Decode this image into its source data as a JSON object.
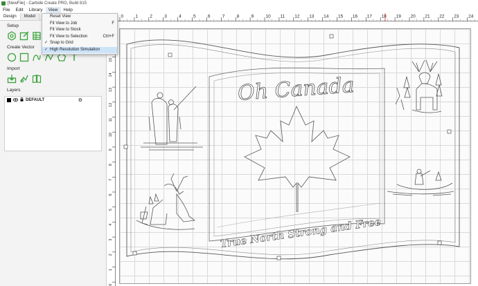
{
  "window": {
    "title": "[NewFile] - Carbide Create PRO, Build 815"
  },
  "menu": {
    "items": [
      "File",
      "Edit",
      "Library",
      "View",
      "Help"
    ],
    "active": "View"
  },
  "view_menu": {
    "items": [
      {
        "label": "Reset View",
        "shortcut": "",
        "checked": false,
        "highlight": false
      },
      {
        "label": "Fit View to Job",
        "shortcut": "F",
        "checked": false,
        "highlight": false
      },
      {
        "label": "Fit View to Stock",
        "shortcut": "",
        "checked": false,
        "highlight": false
      },
      {
        "label": "Fit View to Selection",
        "shortcut": "Ctrl+F",
        "checked": false,
        "highlight": false
      },
      {
        "label": "Snap to Grid",
        "shortcut": "",
        "checked": true,
        "highlight": false
      },
      {
        "label": "High Resolution Simulation",
        "shortcut": "",
        "checked": true,
        "highlight": true
      }
    ]
  },
  "sidebar": {
    "tabs": [
      "Design",
      "Model"
    ],
    "active_tab": "Design",
    "sections": {
      "setup": "Setup",
      "create_vector": "Create Vector",
      "import": "Import",
      "layers": "Layers"
    },
    "layers": [
      {
        "name": "DEFAULT",
        "color": "#000000"
      }
    ]
  },
  "rulers": {
    "horizontal": [
      "0",
      "1",
      "2",
      "3",
      "4",
      "5",
      "6",
      "7",
      "8",
      "9",
      "10",
      "11",
      "12",
      "13",
      "14",
      "15",
      "16",
      "17",
      "18",
      "19",
      "20",
      "21",
      "22",
      "23",
      "24"
    ],
    "vertical": [
      "16",
      "15",
      "14",
      "13",
      "12",
      "11",
      "10",
      "9",
      "8",
      "7",
      "6",
      "5",
      "4",
      "3",
      "2",
      "1",
      "0"
    ]
  },
  "design_text": {
    "title": "Oh Canada",
    "banner": "True North Strong and Free"
  },
  "colors": {
    "accent": "#3aa23a",
    "highlight": "#cce3f8",
    "ruler_marker": "#e03030"
  }
}
